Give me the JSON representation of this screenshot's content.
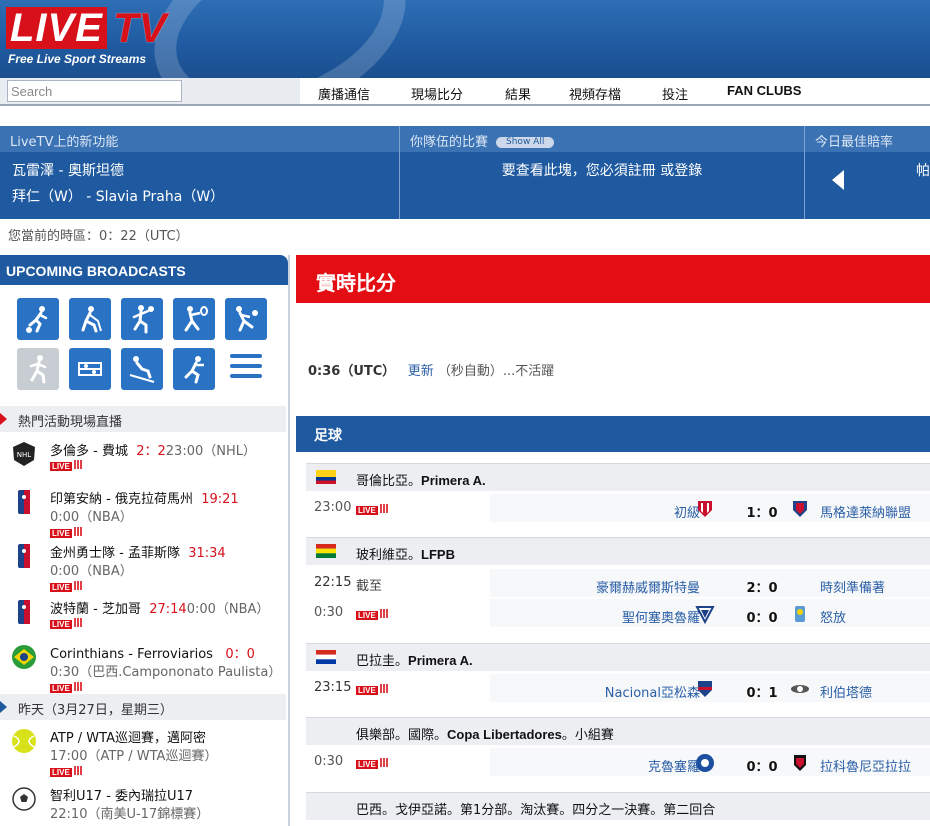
{
  "header": {
    "logo_live": "LIVE",
    "logo_tv": "TV",
    "tagline": "Free Live Sport Streams"
  },
  "search": {
    "placeholder": "Search"
  },
  "nav": [
    "廣播通信",
    "現場比分",
    "結果",
    "視頻存檔",
    "投注",
    "FAN CLUBS"
  ],
  "info": {
    "news_head": "LiveTV上的新功能",
    "news_items": [
      "瓦雷澤 - 奧斯坦德",
      "拜仁（W） - Slavia Praha（W）"
    ],
    "team_head": "你隊伍的比賽",
    "show_all": "Show All",
    "team_msg": "要查看此塊，您必須註冊 或登錄",
    "odds_head": "今日最佳賠率",
    "odds_partial": "帕"
  },
  "timezone": "您當前的時區：0：22（UTC）",
  "sidebar": {
    "title": "UPCOMING BROADCASTS",
    "icons": [
      "football-icon",
      "hockey-icon",
      "basketball-icon",
      "tennis-icon",
      "volleyball-icon",
      "athletics-icon",
      "boxing-icon",
      "skiing-icon",
      "handball-icon",
      "menu-icon"
    ],
    "hot_label": "熱門活動現場直播",
    "yesterday_label": "昨天（3月27日，星期三）",
    "events": [
      {
        "title": "多倫多 - 費城",
        "score": "2：2",
        "sub": "23:00（NHL）",
        "icon": "nhl-icon"
      },
      {
        "title": "印第安納 - 俄克拉荷馬州",
        "score": "19:21",
        "sub": "0:00（NBA）",
        "icon": "nba-icon"
      },
      {
        "title": "金州勇士隊 - 孟菲斯隊",
        "score": "31:34",
        "sub": "0:00（NBA）",
        "icon": "nba-icon"
      },
      {
        "title": "波特蘭 - 芝加哥",
        "score": "27:14",
        "sub": "0:00（NBA）",
        "icon": "nba-icon"
      },
      {
        "title": "Corinthians - Ferroviarios",
        "score": "0：0",
        "sub": "0:30（巴西.Campononato Paulista）",
        "icon": "brazil-flag-icon"
      }
    ],
    "yesterday": [
      {
        "title": "ATP / WTA巡迴賽，邁阿密",
        "sub": "17:00（ATP / WTA巡迴賽）",
        "icon": "tennis-ball-icon"
      },
      {
        "title": "智利U17 - 委內瑞拉U17",
        "sub": "22:10（南美U-17錦標賽）",
        "icon": "soccer-ball-icon"
      }
    ],
    "live_label": "LIVE"
  },
  "main": {
    "title": "實時比分",
    "update_time": "0:36（UTC）",
    "update_link": "更新",
    "update_rest": "（秒自動）...不活躍",
    "sport": "足球",
    "leagues": [
      {
        "country": "哥倫比亞",
        "name": "Primera A.",
        "flag": "colombia-flag-icon",
        "matches": [
          {
            "time": "23:00",
            "live": true,
            "home": "初級",
            "score": "1：0",
            "away": "馬格達萊納聯盟"
          }
        ]
      },
      {
        "country": "玻利維亞",
        "name": "LFPB",
        "flag": "bolivia-flag-icon",
        "matches": [
          {
            "time": "22:15",
            "note": "截至",
            "home": "豪爾赫威爾斯特曼",
            "score": "2：0",
            "away": "時刻準備著"
          },
          {
            "time": "0:30",
            "live": true,
            "home": "聖何塞奧魯羅",
            "score": "0：0",
            "away": "怒放"
          }
        ]
      },
      {
        "country": "巴拉圭",
        "name": "Primera A.",
        "flag": "paraguay-flag-icon",
        "matches": [
          {
            "time": "23:15",
            "live": true,
            "home": "Nacional亞松森",
            "score": "0：1",
            "away": "利伯塔德"
          }
        ]
      },
      {
        "country": "俱樂部。國際",
        "name": "Copa Libertadores",
        "suffix": "。小組賽",
        "flag": "",
        "matches": [
          {
            "time": "0:30",
            "live": true,
            "home": "克魯塞羅",
            "score": "0：0",
            "away": "拉科魯尼亞拉拉"
          }
        ]
      },
      {
        "country": "巴西。戈伊亞諾。第1分部。淘汰賽。四分之一決賽。第二回合",
        "name": "",
        "flag": "",
        "matches": []
      }
    ]
  },
  "colors": {
    "brand_blue": "#1f5aa0",
    "live_red": "#d8101a",
    "header_red": "#e40d14"
  }
}
